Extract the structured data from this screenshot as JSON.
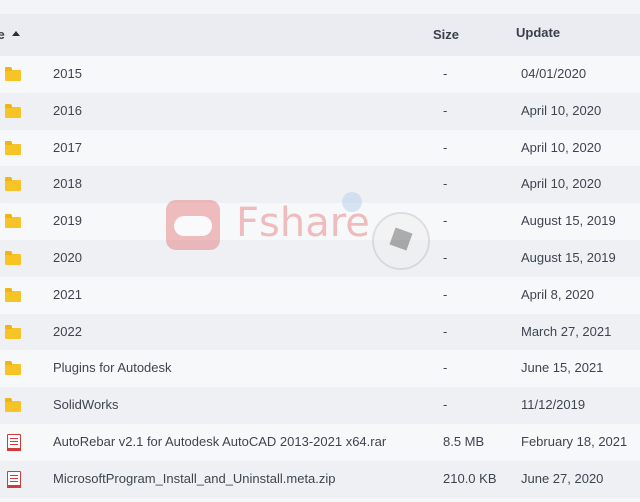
{
  "header": {
    "name_label": "me",
    "size_label": "Size",
    "update_label": "Update"
  },
  "rows": [
    {
      "type": "folder",
      "icon": "folder-icon",
      "name": "2015",
      "size": "-",
      "date": "04/01/2020"
    },
    {
      "type": "folder",
      "icon": "folder-icon",
      "name": "2016",
      "size": "-",
      "date": "April 10, 2020"
    },
    {
      "type": "folder",
      "icon": "folder-icon",
      "name": "2017",
      "size": "-",
      "date": "April 10, 2020"
    },
    {
      "type": "folder",
      "icon": "folder-icon",
      "name": "2018",
      "size": "-",
      "date": "April 10, 2020"
    },
    {
      "type": "folder",
      "icon": "folder-icon",
      "name": "2019",
      "size": "-",
      "date": "August 15, 2019"
    },
    {
      "type": "folder",
      "icon": "folder-icon",
      "name": "2020",
      "size": "-",
      "date": "August 15, 2019"
    },
    {
      "type": "folder",
      "icon": "folder-icon",
      "name": "2021",
      "size": "-",
      "date": "April 8, 2020"
    },
    {
      "type": "folder",
      "icon": "folder-icon",
      "name": "2022",
      "size": "-",
      "date": "March 27, 2021"
    },
    {
      "type": "folder",
      "icon": "folder-icon",
      "name": "Plugins for Autodesk",
      "size": "-",
      "date": "June 15, 2021"
    },
    {
      "type": "folder",
      "icon": "folder-icon",
      "name": "SolidWorks",
      "size": "-",
      "date": "11/12/2019"
    },
    {
      "type": "file",
      "icon": "archive-file-icon",
      "name": "AutoRebar v2.1 for Autodesk AutoCAD 2013-2021 x64.rar",
      "size": "8.5 MB",
      "date": "February 18, 2021"
    },
    {
      "type": "file",
      "icon": "archive-file-icon",
      "name": "MicrosoftProgram_Install_and_Uninstall.meta.zip",
      "size": "210.0 KB",
      "date": "June 27, 2020"
    }
  ],
  "watermark": {
    "text": "Fshare",
    "icon": "fshare-logo-icon",
    "ball_icon": "soccer-ball-icon"
  },
  "colors": {
    "folder": "#f7c427",
    "file_icon": "#d23b3b",
    "header_bg": "#eaecf1",
    "row_alt": "#eef0f4"
  }
}
